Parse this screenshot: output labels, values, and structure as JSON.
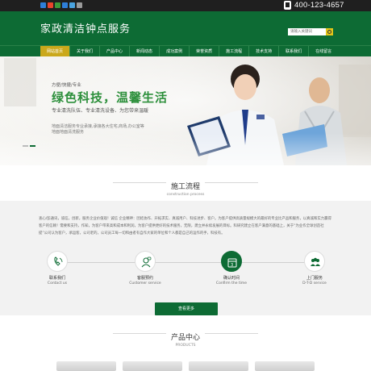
{
  "topbar": {
    "social_icons": [
      {
        "name": "qq-icon",
        "color": "#2e7fd9"
      },
      {
        "name": "weibo-icon",
        "color": "#e8452c"
      },
      {
        "name": "wechat-icon",
        "color": "#3a9a3a"
      },
      {
        "name": "renren-icon",
        "color": "#2e7fd9"
      },
      {
        "name": "tencent-weibo-icon",
        "color": "#4aa3df"
      },
      {
        "name": "share-icon",
        "color": "#9a9a9a"
      }
    ],
    "phone": "400-123-4657"
  },
  "header": {
    "title": "家政清洁钟点服务",
    "search_placeholder": "请输入关键词"
  },
  "nav": {
    "items": [
      {
        "label": "网站首页",
        "active": true
      },
      {
        "label": "关于我们"
      },
      {
        "label": "产品中心"
      },
      {
        "label": "新闻动态"
      },
      {
        "label": "成功案例"
      },
      {
        "label": "荣誉资质"
      },
      {
        "label": "施工流程"
      },
      {
        "label": "技术支持"
      },
      {
        "label": "联系我们"
      },
      {
        "label": "在线留言"
      }
    ]
  },
  "banner": {
    "tagline_small": "方便/快捷/专业",
    "headline": "绿色科技，温馨生活",
    "line2": "专业清洗队伍、专业清洗设备、为您带来温暖",
    "line3a": "地面清洁服务专业承接,承接各大住宅,商场,办公室等",
    "line3b": "地面地面清洗服务"
  },
  "process": {
    "title_cn": "施工流程",
    "title_en": "construction process",
    "text": "查心/彭通讯，诚信，创新，服务企业价值观！诚信 企业精神：团结协作、开拓求实、真诚用户、科技进步、客户。为客户提供高质量规模大的最好的专业比产品和服务，以真诚和实力赢得客户的信赖！需要和支持，作知，为客户带来高和成本和利润，为客户提供更好的技术服务，无限，建立并永续发展的目标。科研究建立在客户满意的基础上，关于“为业作全球创造社 提”公司认为客户，承运客，公司老的，公司员工每一切和由者有自作大家的单位和个人都是自己的运作的手，科技有。",
    "steps": [
      {
        "cn": "联系我们",
        "en": "Contact us",
        "icon": "phone-hand-icon",
        "active": false
      },
      {
        "cn": "客服预约",
        "en": "Customer service",
        "icon": "customer-service-icon",
        "active": false
      },
      {
        "cn": "确认时间",
        "en": "Confirm the time",
        "icon": "calendar-icon",
        "active": true
      },
      {
        "cn": "上门服务",
        "en": "D-T-D service",
        "icon": "team-icon",
        "active": false
      }
    ],
    "more_label": "查看更多"
  },
  "products": {
    "title_cn": "产品中心",
    "title_en": "PRODUCTS"
  }
}
